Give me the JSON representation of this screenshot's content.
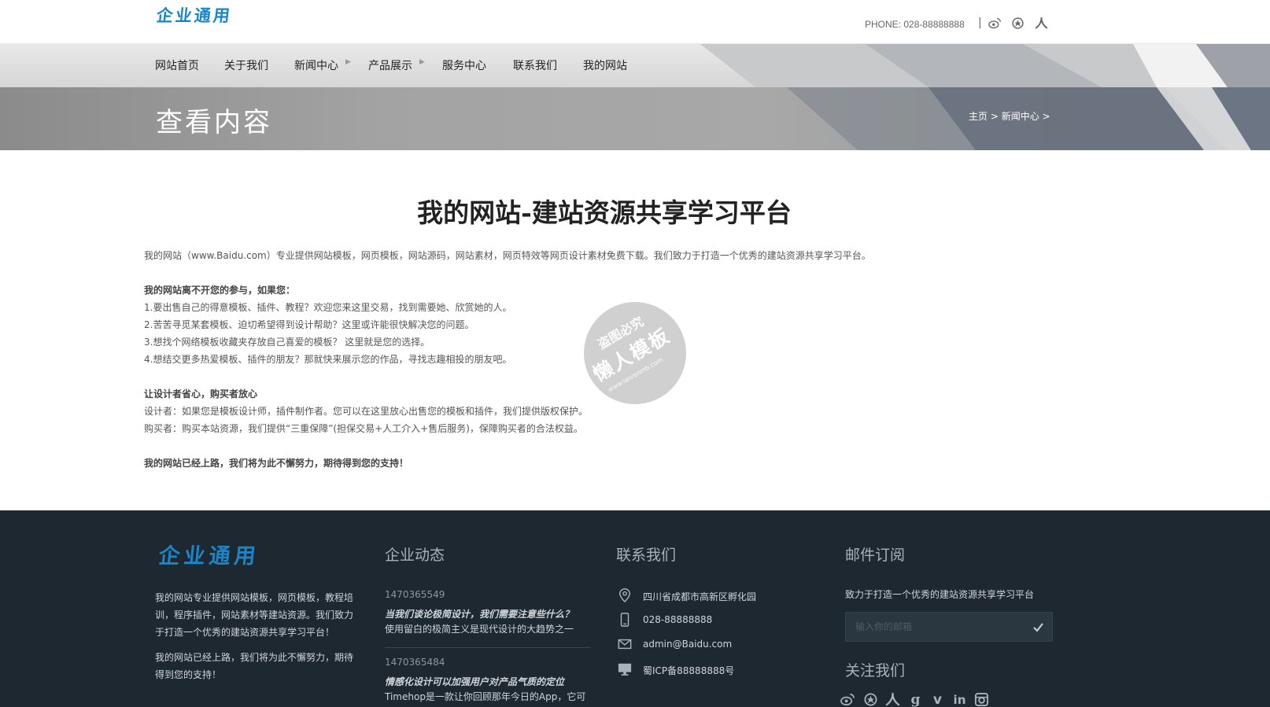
{
  "header": {
    "logo_text": "企业通用",
    "phone": "PHONE: 028-88888888",
    "separator": "|",
    "social_icons": [
      "weibo-icon",
      "qzone-icon",
      "renren-icon"
    ]
  },
  "nav": {
    "items": [
      {
        "label": "网站首页",
        "has_submenu": false
      },
      {
        "label": "关于我们",
        "has_submenu": false
      },
      {
        "label": "新闻中心",
        "has_submenu": true
      },
      {
        "label": "产品展示",
        "has_submenu": true
      },
      {
        "label": "服务中心",
        "has_submenu": false
      },
      {
        "label": "联系我们",
        "has_submenu": false
      },
      {
        "label": "我的网站",
        "has_submenu": false
      }
    ]
  },
  "banner": {
    "title": "查看内容",
    "breadcrumb": [
      "主页",
      "新闻中心"
    ],
    "breadcrumb_sep": ">"
  },
  "article": {
    "title": "我的网站-建站资源共享学习平台",
    "intro": "我的网站（www.Baidu.com）专业提供网站模板，网页模板，网站源码，网站素材，网页特效等网页设计素材免费下载。我们致力于打造一个优秀的建站资源共享学习平台。",
    "section1_heading": "我的网站离不开您的参与，如果您：",
    "section1_items": [
      "1.要出售自己的得意模板、插件、教程？欢迎您来这里交易，找到需要她、欣赏她的人。",
      "2.苦苦寻觅某套模板、迫切希望得到设计帮助？这里或许能很快解决您的问题。",
      "3.想找个网络模板收藏夹存放自己喜爱的模板？ 这里就是您的选择。",
      "4.想结交更多热爱模板、插件的朋友？那就快来展示您的作品，寻找志趣相投的朋友吧。"
    ],
    "section2_heading": "让设计者省心，购买者放心",
    "section2_items": [
      "设计者：如果您是模板设计师，插件制作者。您可以在这里放心出售您的模板和插件，我们提供版权保护。",
      "购买者：购买本站资源，我们提供“三重保障”(担保交易+人工介入+售后服务)，保障购买者的合法权益。"
    ],
    "closing": "我的网站已经上路，我们将为此不懈努力，期待得到您的支持！"
  },
  "watermark": {
    "line1": "盗图必究",
    "line2": "懒人模板",
    "line3": "www.lanrenmb.com"
  },
  "footer": {
    "logo_text": "企业通用",
    "about_lines": [
      "我的网站专业提供网站模板，网页模板，教程培",
      "训，程序插件，网站素材等建站资源。我们致力",
      "于打造一个优秀的建站资源共享学习平台！"
    ],
    "about_lines2": [
      "我的网站已经上路，我们将为此不懈努力，期待",
      "得到您的支持！"
    ],
    "news_heading": "企业动态",
    "news": [
      {
        "date": "1470365549",
        "title": "当我们谈论极简设计，我们需要注意些什么？",
        "excerpt": "使用留白的极简主义是现代设计的大趋势之一"
      },
      {
        "date": "1470365484",
        "title": "情感化设计可以加强用户对产品气质的定位",
        "excerpt": "Timehop是一款让你回顾那年今日的App，它可"
      }
    ],
    "contact_heading": "联系我们",
    "contact": [
      {
        "icon": "location-pin-icon",
        "text": "四川省成都市高新区孵化园"
      },
      {
        "icon": "mobile-phone-icon",
        "text": "028-88888888"
      },
      {
        "icon": "envelope-icon",
        "text": "admin@Baidu.com"
      },
      {
        "icon": "monitor-icon",
        "text": "蜀ICP备88888888号"
      }
    ],
    "subscribe_heading": "邮件订阅",
    "subscribe_text": "致力于打造一个优秀的建站资源共享学习平台",
    "email_placeholder": "输入你的邮箱",
    "follow_heading": "关注我们",
    "follow_icons": [
      "weibo-icon",
      "qzone-icon",
      "renren-icon",
      "google-icon",
      "vimeo-icon",
      "linkedin-icon",
      "instagram-icon"
    ]
  },
  "colors": {
    "brand_blue": "#1a86c9",
    "footer_bg": "#1d2830",
    "nav_bg": "#dcdcdc"
  }
}
